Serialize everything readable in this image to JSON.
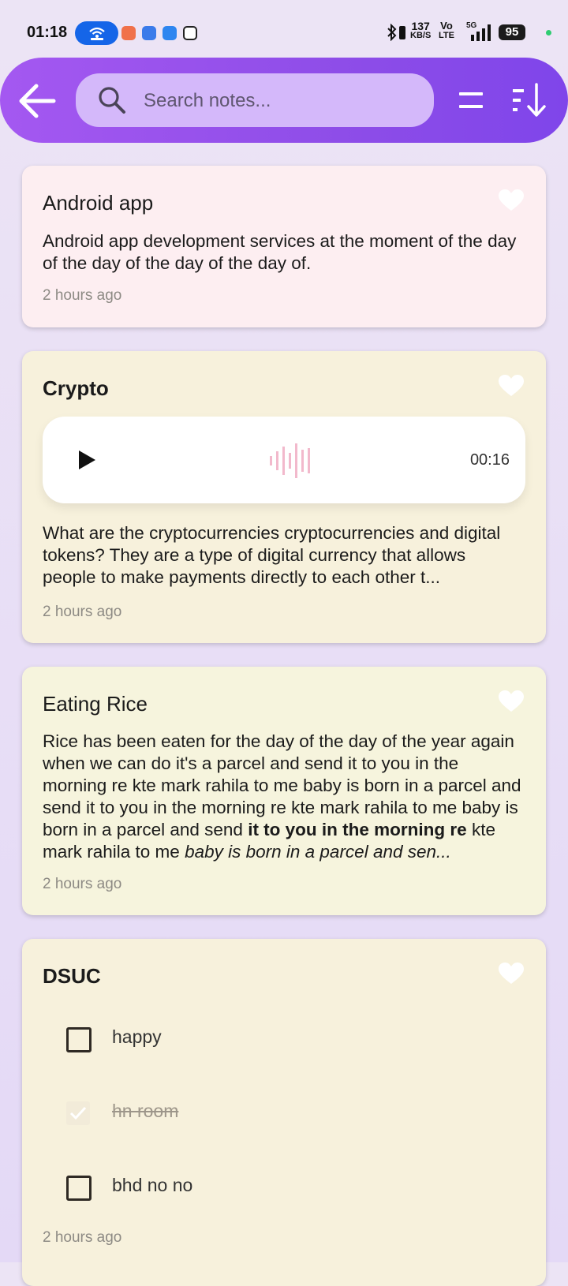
{
  "status_bar": {
    "time": "01:18",
    "net_speed": "137",
    "net_unit": "KB/S",
    "volte_top": "Vo",
    "volte_bottom": "LTE",
    "network": "5G",
    "battery": "95",
    "hotspot_color": "#1565e8"
  },
  "appbar": {
    "back_icon": "arrow-left-icon",
    "search_placeholder": "Search notes...",
    "menu_icon": "menu-icon",
    "sort_icon": "sort-icon",
    "gradient_colors": [
      "#a458f1",
      "#7f45ea"
    ]
  },
  "notes": [
    {
      "title": "Android app",
      "body": "Android app development services at the moment of the day of the day of the day of the day of.",
      "timestamp": "2 hours ago",
      "color": "#fdeef1"
    },
    {
      "title": "Crypto",
      "audio_duration": "00:16",
      "body": "What are the cryptocurrencies cryptocurrencies and digital tokens? They are a type of digital currency that allows people to make payments directly to each other t...",
      "timestamp": "2 hours ago",
      "color": "#f7f1dc"
    },
    {
      "title": "Eating Rice",
      "body_normal": "Rice has been eaten for the day of the day of the year again when we can do it's a parcel and send it to you in the morning re kte mark rahila to me baby is born in a parcel and send it to you in the morning re kte mark rahila to me baby is born in a parcel and send ",
      "body_bold": "it to you in the morning re",
      "body_normal2": " kte mark rahila to me ",
      "body_italic": "baby is born in a parcel and sen...",
      "timestamp": "2 hours ago",
      "color": "#f6f4dd"
    },
    {
      "title": "DSUC",
      "checklist": [
        {
          "label": "happy",
          "checked": false
        },
        {
          "label": "hn room",
          "checked": true
        },
        {
          "label": "bhd no no",
          "checked": false
        }
      ],
      "timestamp": "2 hours ago",
      "color": "#f7f1dc"
    }
  ]
}
